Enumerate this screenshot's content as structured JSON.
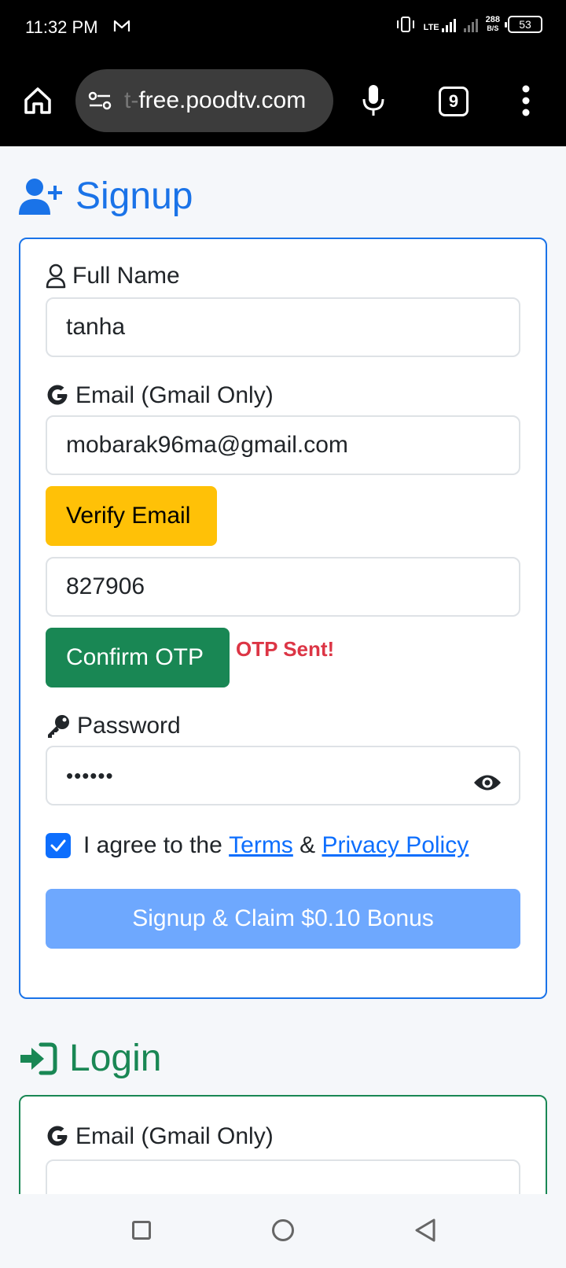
{
  "status_bar": {
    "time": "11:32 PM",
    "network": "LTE",
    "speed_value": "288",
    "speed_unit": "B/S",
    "battery": "53",
    "icons": [
      "mail-icon",
      "vibrate-icon",
      "signal-icon",
      "battery-icon"
    ]
  },
  "browser": {
    "url_prefix": "t-",
    "url_main": "free.poodtv.com",
    "tab_count": "9",
    "icons": [
      "home-icon",
      "site-settings-icon",
      "mic-icon",
      "tabs-icon",
      "more-icon"
    ]
  },
  "signup": {
    "heading": "Signup",
    "heading_icon": "user-plus-icon",
    "full_name_label": "Full Name",
    "full_name_value": "tanha",
    "email_label": "Email (Gmail Only)",
    "email_value": "mobarak96ma@gmail.com",
    "verify_label": "Verify Email",
    "otp_value": "827906",
    "confirm_label": "Confirm OTP",
    "otp_status": "OTP Sent!",
    "password_label": "Password",
    "password_value": "••••••",
    "agree_text": "I agree to the",
    "terms_link": "Terms",
    "amp": "&",
    "privacy_link": "Privacy Policy",
    "submit_label": "Signup & Claim $0.10 Bonus",
    "agree_checked": true
  },
  "login": {
    "heading": "Login",
    "heading_icon": "sign-in-icon",
    "email_label": "Email (Gmail Only)",
    "email_value": ""
  },
  "colors": {
    "signup_accent": "#1a73e8",
    "login_accent": "#198754",
    "verify_button": "#ffc107",
    "confirm_button": "#198754",
    "submit_button": "#6ea8fe",
    "otp_status": "#dc3545"
  }
}
